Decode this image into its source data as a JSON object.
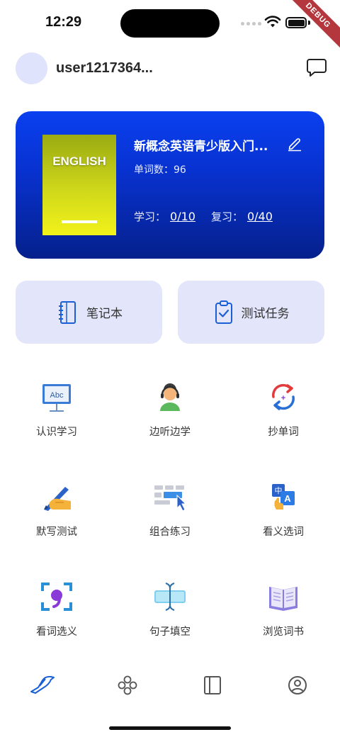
{
  "status_bar": {
    "time": "12:29",
    "debug_label": "DEBUG"
  },
  "user": {
    "name": "user1217364..."
  },
  "book": {
    "cover_label": "ENGLISH",
    "title": "新概念英语青少版入门...",
    "word_count_label": "单词数：",
    "word_count": "96",
    "study_label": "学习：",
    "study_value": "0/10",
    "review_label": "复习：",
    "review_value": "0/40"
  },
  "quick_actions": {
    "notebook_label": "笔记本",
    "test_label": "测试任务"
  },
  "features": [
    {
      "label": "认识学习",
      "icon": "flashcard-board-icon"
    },
    {
      "label": "边听边学",
      "icon": "headphone-person-icon"
    },
    {
      "label": "抄单词",
      "icon": "copy-words-icon"
    },
    {
      "label": "默写测试",
      "icon": "writing-hand-icon"
    },
    {
      "label": "组合练习",
      "icon": "keyboard-select-icon"
    },
    {
      "label": "看义选词",
      "icon": "translate-tap-icon"
    },
    {
      "label": "看词选义",
      "icon": "scan-word-icon"
    },
    {
      "label": "句子填空",
      "icon": "text-cursor-icon"
    },
    {
      "label": "浏览词书",
      "icon": "open-book-icon"
    }
  ],
  "bottom_nav": [
    "bird-home-icon",
    "gamepad-icon",
    "book-panel-icon",
    "profile-icon"
  ],
  "colors": {
    "card_top": "#0a40f0",
    "card_bottom": "#05208c",
    "quick_bg": "#e3e6fa",
    "accent": "#1a5fd6"
  }
}
